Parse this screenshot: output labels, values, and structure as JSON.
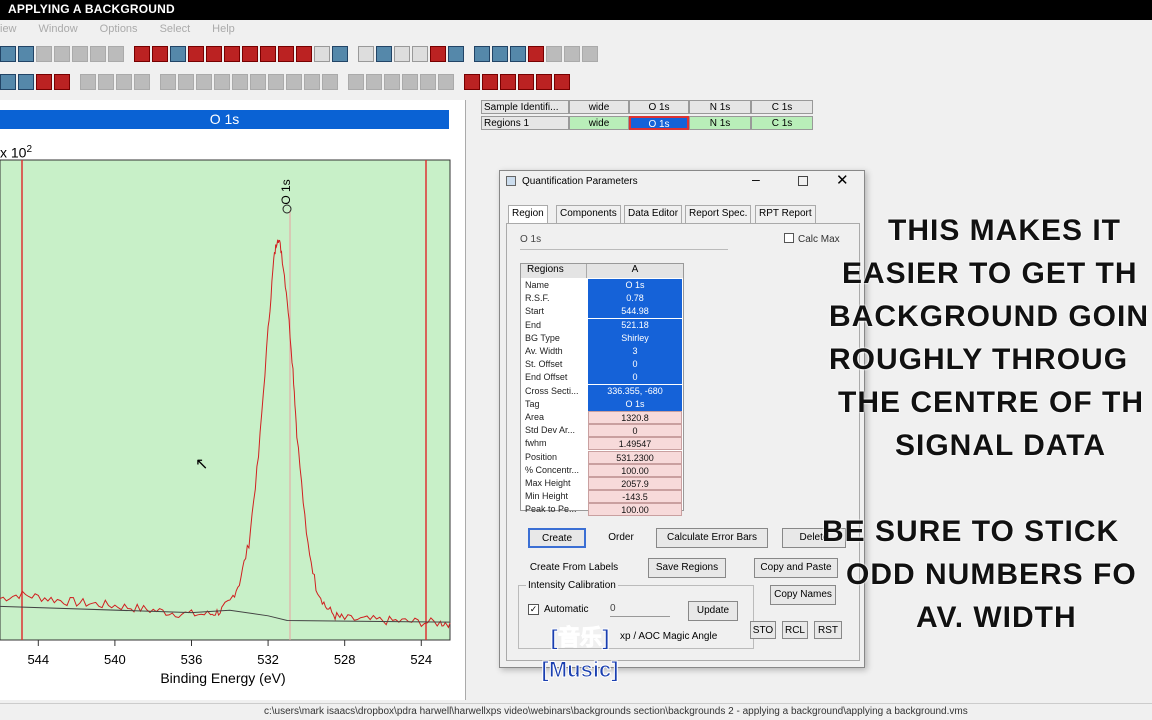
{
  "window": {
    "title": "APPLYING A BACKGROUND"
  },
  "menu": [
    "iew",
    "Window",
    "Options",
    "Select",
    "Help"
  ],
  "plot": {
    "title": "O 1s",
    "multiplier": "x 10",
    "multiplier_exp": "2",
    "peak_label": "O 1s",
    "xlabel": "Binding Energy (eV)",
    "xticks": [
      "544",
      "540",
      "536",
      "532",
      "528",
      "524"
    ]
  },
  "chart_data": {
    "type": "line",
    "title": "O 1s",
    "xlabel": "Binding Energy (eV)",
    "x_reversed": true,
    "xlim": [
      546,
      522.5
    ],
    "series": [
      {
        "name": "O 1s",
        "x": [
          546,
          545,
          544,
          543,
          542,
          541,
          540,
          539,
          538,
          537,
          536,
          535,
          534.5,
          534,
          533.5,
          533,
          532.5,
          532,
          531.7,
          531.5,
          531.3,
          531,
          530.7,
          530.5,
          530,
          529.5,
          529,
          528.5,
          528,
          527,
          526,
          525,
          524,
          523,
          522.5
        ],
        "y": [
          0.4,
          0.45,
          0.42,
          0.38,
          0.35,
          0.33,
          0.31,
          0.28,
          0.25,
          0.22,
          0.2,
          0.2,
          0.24,
          0.35,
          0.6,
          1.1,
          2.2,
          3.8,
          4.7,
          5.0,
          4.8,
          4.2,
          3.3,
          2.5,
          1.2,
          0.55,
          0.3,
          0.18,
          0.14,
          0.13,
          0.12,
          0.11,
          0.1,
          0.09,
          0.09
        ]
      }
    ]
  },
  "grid": {
    "row1": [
      "Sample Identifi...",
      "wide",
      "O 1s",
      "N 1s",
      "C 1s"
    ],
    "row2": [
      "Regions 1",
      "wide",
      "O 1s",
      "N 1s",
      "C 1s"
    ]
  },
  "dialog": {
    "title": "Quantification Parameters",
    "tabs": [
      "Region",
      "Components",
      "Data Editor",
      "Report Spec.",
      "RPT Report"
    ],
    "region_field": "O 1s",
    "calc_max": "Calc Max",
    "table_header": [
      "Regions",
      "A"
    ],
    "rows": [
      {
        "label": "Name",
        "value": "O 1s",
        "style": "blue"
      },
      {
        "label": "R.S.F.",
        "value": "0.78",
        "style": "blue"
      },
      {
        "label": "Start",
        "value": "544.98",
        "style": "blue"
      },
      {
        "label": "End",
        "value": "521.18",
        "style": "blue"
      },
      {
        "label": "BG Type",
        "value": "Shirley",
        "style": "blue"
      },
      {
        "label": "Av. Width",
        "value": "3",
        "style": "blue"
      },
      {
        "label": "St. Offset",
        "value": "0",
        "style": "blue"
      },
      {
        "label": "End Offset",
        "value": "0",
        "style": "blue"
      },
      {
        "label": "Cross Secti...",
        "value": "336.355, -680",
        "style": "blue"
      },
      {
        "label": "Tag",
        "value": "O 1s",
        "style": "blue"
      },
      {
        "label": "Area",
        "value": "1320.8",
        "style": "pink"
      },
      {
        "label": "Std Dev Ar...",
        "value": "0",
        "style": "pink"
      },
      {
        "label": "fwhm",
        "value": "1.49547",
        "style": "pink"
      },
      {
        "label": "Position",
        "value": "531.2300",
        "style": "pink"
      },
      {
        "label": "% Concentr...",
        "value": "100.00",
        "style": "pink"
      },
      {
        "label": "Max Height",
        "value": "2057.9",
        "style": "pink"
      },
      {
        "label": "Min Height",
        "value": "-143.5",
        "style": "pink"
      },
      {
        "label": "Peak to Pe...",
        "value": "100.00",
        "style": "pink"
      }
    ],
    "buttons": {
      "create": "Create",
      "order": "Order",
      "calc_error": "Calculate Error Bars",
      "delete": "Delete",
      "create_from_labels": "Create From Labels",
      "save_regions": "Save Regions",
      "copy_paste": "Copy and Paste",
      "copy_names": "Copy Names",
      "update": "Update",
      "sto": "STO",
      "rcl": "RCL",
      "rst": "RST"
    },
    "intensity_calibration": "Intensity Calibration",
    "automatic": "Automatic",
    "calib_value": "0",
    "magic_angle": "xp  / AOC Magic Angle"
  },
  "overlay": {
    "lines1": [
      "THIS MAKES IT",
      "EASIER TO GET TH",
      "BACKGROUND GOIN",
      "ROUGHLY THROUG",
      "THE CENTRE OF TH",
      "SIGNAL DATA"
    ],
    "lines2": [
      "BE SURE TO STICK",
      "ODD NUMBERS FO",
      "AV. WIDTH"
    ]
  },
  "subtitle": {
    "line1": "[音乐]",
    "line2": "[Music]"
  },
  "status": {
    "path": "c:\\users\\mark isaacs\\dropbox\\pdra harwell\\harwellxps video\\webinars\\backgrounds section\\backgrounds 2 - applying a background\\applying a background.vms"
  }
}
